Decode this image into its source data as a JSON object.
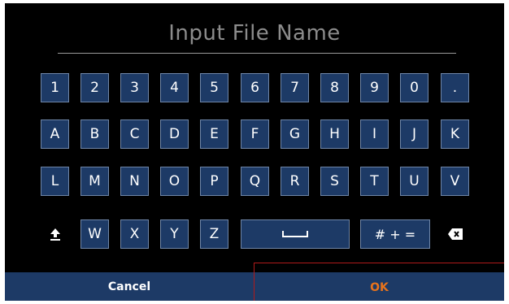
{
  "dialog": {
    "title": "Input File Name"
  },
  "keyboard": {
    "row1": [
      "1",
      "2",
      "3",
      "4",
      "5",
      "6",
      "7",
      "8",
      "9",
      "0",
      "."
    ],
    "row2": [
      "A",
      "B",
      "C",
      "D",
      "E",
      "F",
      "G",
      "H",
      "I",
      "J",
      "K"
    ],
    "row3": [
      "L",
      "M",
      "N",
      "O",
      "P",
      "Q",
      "R",
      "S",
      "T",
      "U",
      "V"
    ],
    "row4": [
      "W",
      "X",
      "Y",
      "Z"
    ],
    "symbols_label": "# + =",
    "icons": {
      "shift": "shift-up-arrow",
      "space": "space-bar",
      "backspace": "backspace-x"
    }
  },
  "actions": {
    "cancel_label": "Cancel",
    "ok_label": "OK"
  },
  "colors": {
    "background": "#000000",
    "key_fill": "#1d3a66",
    "key_border": "#6f86a8",
    "title": "#8c8c8c",
    "ok_text": "#e8731b",
    "focus_outline": "#b01a1a"
  }
}
